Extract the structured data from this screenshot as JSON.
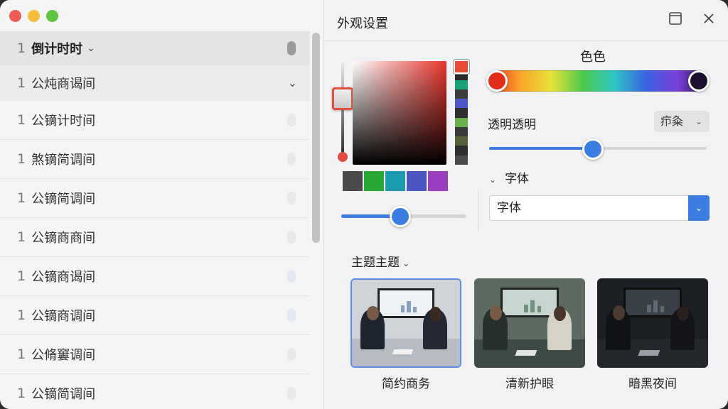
{
  "list": {
    "rows": [
      {
        "num": "1",
        "title": "倒计时时"
      },
      {
        "num": "1",
        "title": "公炖商谒间"
      },
      {
        "num": "1",
        "title": "公镝计时间"
      },
      {
        "num": "1",
        "title": "煞镝简调间"
      },
      {
        "num": "1",
        "title": "公镝简调间"
      },
      {
        "num": "1",
        "title": "公镝商商间"
      },
      {
        "num": "1",
        "title": "公镝商谒间"
      },
      {
        "num": "1",
        "title": "公镝商调间"
      },
      {
        "num": "1",
        "title": "公脩窶调间"
      },
      {
        "num": "1",
        "title": "公镝简调间"
      }
    ]
  },
  "panel": {
    "title": "外观设置",
    "color_label": "色色",
    "opacity_label": "透明透明",
    "opacity_select": "疖粂",
    "font_heading": "字体",
    "font_value": "字体",
    "theme_heading": "主题主题",
    "themes": [
      {
        "label": "简约商务"
      },
      {
        "label": "清新护眼"
      },
      {
        "label": "暗黑夜间"
      }
    ]
  },
  "colors": {
    "accent": "#3b7de0",
    "hue_column": [
      "#e84a3a",
      "#2b2b2b",
      "#1aa37a",
      "#3c3c3c",
      "#4d55c8",
      "#2f2f2f",
      "#68b04a",
      "#3a3a3a",
      "#56613c",
      "#2f2f2f",
      "#4a4a4a"
    ],
    "swatches": [
      "#4a4a4a",
      "#27a837",
      "#1c9bb0",
      "#4b55c4",
      "#9a3fc0"
    ]
  }
}
